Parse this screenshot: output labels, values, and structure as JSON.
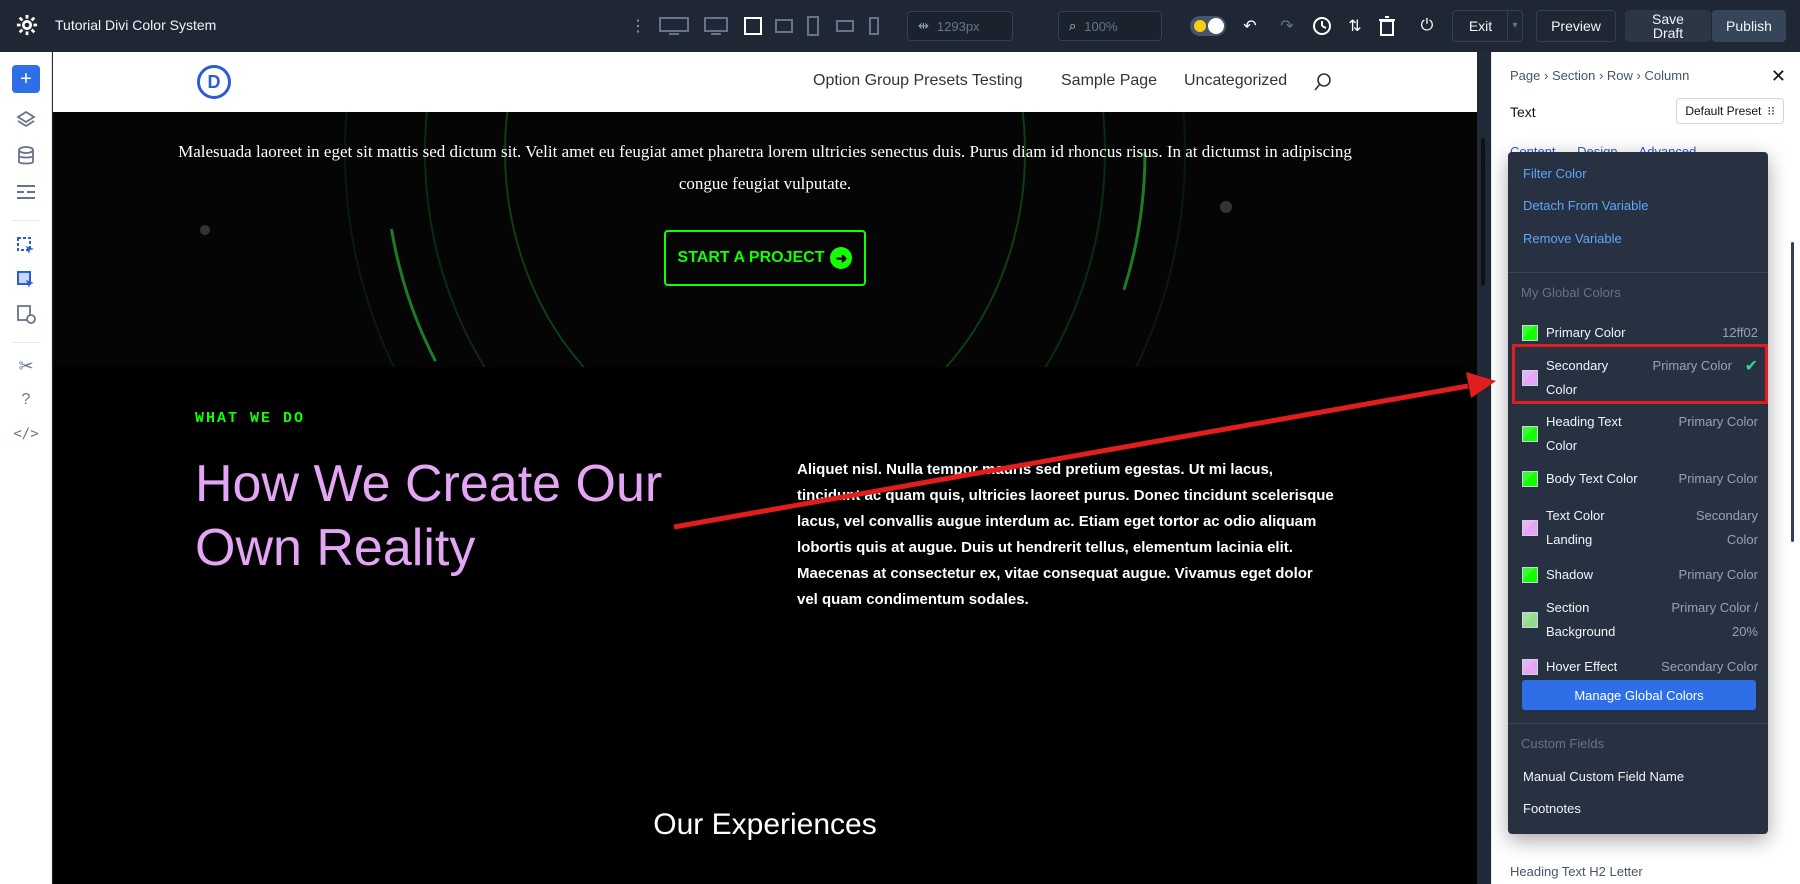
{
  "topbar": {
    "title": "Tutorial Divi Color System",
    "width_value": "1293px",
    "zoom_value": "100%",
    "exit_label": "Exit",
    "preview_label": "Preview",
    "save_draft_label": "Save Draft",
    "publish_label": "Publish"
  },
  "site": {
    "logo": "D",
    "nav": [
      "Option Group Presets Testing",
      "Sample Page",
      "Uncategorized"
    ],
    "hero_text": "Malesuada laoreet in eget sit mattis sed dictum sit. Velit amet eu feugiat amet pharetra lorem ultricies senectus duis. Purus diam id rhoncus risus. In at dictumst in adipiscing congue feugiat vulputate.",
    "hero_button": "START A PROJECT",
    "eyebrow": "WHAT WE DO",
    "headline": "How We Create Our Own Reality",
    "body_copy": "Aliquet nisl. Nulla tempor mauris sed pretium egestas. Ut mi lacus, tincidunt ac quam quis, ultricies laoreet purus. Donec tincidunt scelerisque lacus, vel convallis augue interdum ac. Etiam eget tortor ac odio aliquam lobortis quis at augue. Duis ut hendrerit tellus, elementum lacinia elit. Maecenas at consectetur ex, vitae consequat augue. Vivamus eget dolor vel quam condimentum sodales.",
    "experiences_title": "Our Experiences"
  },
  "panel": {
    "breadcrumbs": [
      "Page",
      "Section",
      "Row",
      "Column"
    ],
    "module_label": "Text",
    "preset_label": "Default Preset",
    "tabs": [
      "Content",
      "Design",
      "Advanced"
    ],
    "footer_label": "Heading Text H2 Letter"
  },
  "dropdown": {
    "actions": [
      "Filter Color",
      "Detach From Variable",
      "Remove Variable"
    ],
    "global_heading": "My Global Colors",
    "colors": [
      {
        "name": "Primary Color",
        "value": "12ff02",
        "swatch": "#12ff02",
        "selected": false
      },
      {
        "name": "Secondary Color",
        "value": "Primary Color",
        "swatch": "#e5a5f5",
        "selected": true
      },
      {
        "name": "Heading Text Color",
        "value": "Primary Color",
        "swatch": "#12ff02",
        "selected": false
      },
      {
        "name": "Body Text Color",
        "value": "Primary Color",
        "swatch": "#12ff02",
        "selected": false
      },
      {
        "name": "Text Color Landing",
        "value": "Secondary Color",
        "swatch": "#e5a5f5",
        "selected": false
      },
      {
        "name": "Shadow",
        "value": "Primary Color",
        "swatch": "#12ff02",
        "selected": false
      },
      {
        "name": "Section Background",
        "value": "Primary Color / 20%",
        "swatch": "#8fdc8a",
        "selected": false
      },
      {
        "name": "Hover Effect",
        "value": "Secondary Color",
        "swatch": "#e5a5f5",
        "selected": false
      }
    ],
    "manage_label": "Manage Global Colors",
    "custom_heading": "Custom Fields",
    "custom_fields": [
      "Manual Custom Field Name",
      "Footnotes"
    ]
  },
  "colors": {
    "primary": "#12ff02",
    "secondary": "#e5a5f5",
    "accent_blue": "#2e6fe8",
    "annotation_red": "#e11d1d"
  }
}
